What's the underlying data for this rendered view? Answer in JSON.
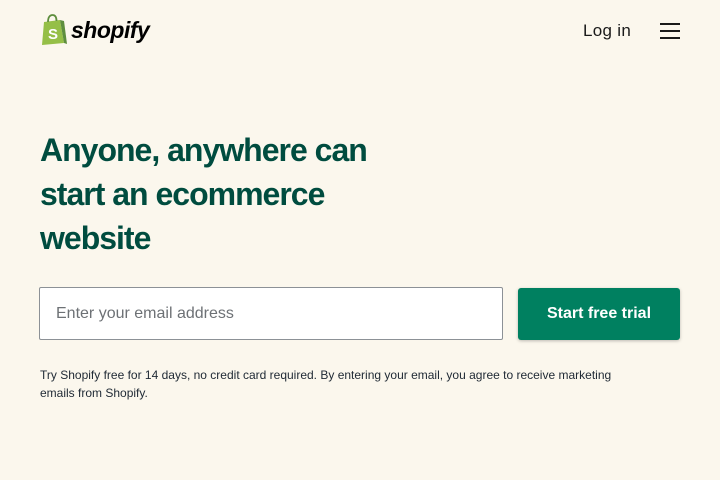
{
  "brand": {
    "name": "shopify",
    "logo_colors": {
      "bag_light": "#95bf47",
      "bag_dark": "#5e8e3e",
      "letter": "#ffffff"
    }
  },
  "header": {
    "login_label": "Log in",
    "menu_icon": "hamburger-menu-icon"
  },
  "hero": {
    "headline": "Anyone, anywhere can start an ecommerce website",
    "email_placeholder": "Enter your email address",
    "email_value": "",
    "cta_label": "Start free trial",
    "disclaimer": "Try Shopify free for 14 days, no credit card required. By entering your email, you agree to receive marketing emails from Shopify."
  },
  "colors": {
    "background": "#fbf7ed",
    "headline": "#004c3f",
    "cta": "#008060",
    "cta_text": "#ffffff"
  }
}
